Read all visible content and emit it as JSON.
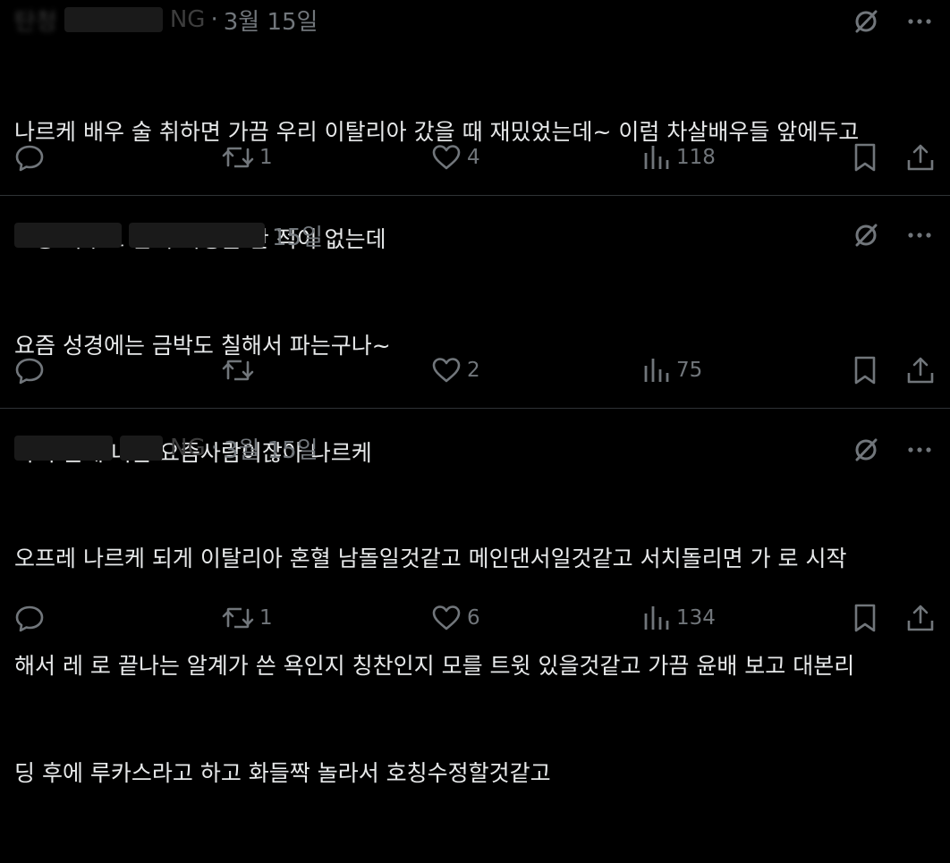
{
  "posts": [
    {
      "author_visible": "NG",
      "separator": "·",
      "date": "3월 15일",
      "text_lines": [
        "나르케 배우 술 취하면 가끔 우리 이탈리아 갔을 때 재밌었는데~ 이럼 차살배우들 앞에두고",
        "그중 아무도 단체 여행을 간 적이 없는데"
      ],
      "replies": "",
      "reposts": "1",
      "likes": "4",
      "views": "118"
    },
    {
      "author_visible": "",
      "separator": "",
      "date": "15일",
      "text_lines": [
        "요즘 성경에는 금박도 칠해서 파는구나~",
        "아니 근데 너는 요즘사람이잖아 나르케"
      ],
      "replies": "",
      "reposts": "",
      "likes": "2",
      "views": "75"
    },
    {
      "author_visible": "NG",
      "separator": "·",
      "date": "3월 15일",
      "text_lines": [
        "오프레 나르케 되게 이탈리아 혼혈 남돌일것같고 메인댄서일것같고 서치돌리면 가 로 시작",
        "해서 레 로 끝나는 알계가 쓴 욕인지 칭찬인지 모를 트윗 있을것같고 가끔 윤배 보고 대본리",
        "딩 후에 루카스라고 하고 화들짝 놀라서 호칭수정할것같고"
      ],
      "replies": "",
      "reposts": "1",
      "likes": "6",
      "views": "134"
    }
  ],
  "icons": {
    "reply": "reply-icon",
    "repost": "repost-icon",
    "like": "like-icon",
    "views": "views-icon",
    "bookmark": "bookmark-icon",
    "share": "share-icon",
    "grok": "grok-icon",
    "more": "more-icon"
  },
  "colors": {
    "background": "#000000",
    "text": "#e7e9ea",
    "muted": "#71767b",
    "divider": "#2f3336"
  }
}
